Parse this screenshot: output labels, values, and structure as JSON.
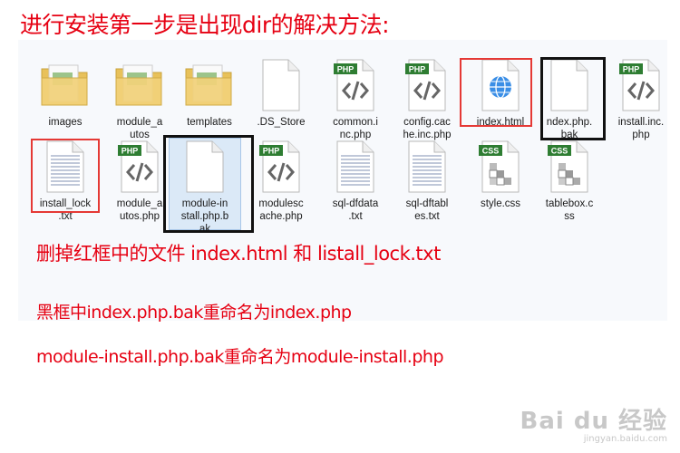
{
  "heading": "进行安装第一步是出现dir的解决方法:",
  "files": [
    {
      "name": "images",
      "icon": "folder-icon"
    },
    {
      "name": "module_a\nutos",
      "icon": "folder-icon"
    },
    {
      "name": "templates",
      "icon": "folder-icon"
    },
    {
      "name": ".DS_Store",
      "icon": "generic-file-icon"
    },
    {
      "name": "common.i\nnc.php",
      "icon": "php-file-icon",
      "badge": "PHP"
    },
    {
      "name": "config.cac\nhe.inc.php",
      "icon": "php-file-icon",
      "badge": "PHP"
    },
    {
      "name": "index.html",
      "icon": "html-file-icon"
    },
    {
      "name": "ndex.php.\nbak",
      "icon": "generic-file-icon"
    },
    {
      "name": "install.inc.\nphp",
      "icon": "php-file-icon",
      "badge": "PHP"
    },
    {
      "name": "install_lock\n.txt",
      "icon": "text-file-icon"
    },
    {
      "name": "module_a\nutos.php",
      "icon": "php-file-icon",
      "badge": "PHP"
    },
    {
      "name": "module-in\nstall.php.b\nak",
      "icon": "generic-file-icon"
    },
    {
      "name": "modulesc\nache.php",
      "icon": "php-file-icon",
      "badge": "PHP"
    },
    {
      "name": "sql-dfdata\n.txt",
      "icon": "text-file-icon"
    },
    {
      "name": "sql-dftabl\nes.txt",
      "icon": "text-file-icon"
    },
    {
      "name": "style.css",
      "icon": "css-file-icon",
      "badge": "CSS"
    },
    {
      "name": "tablebox.c\nss",
      "icon": "css-file-icon",
      "badge": "CSS"
    }
  ],
  "notes": {
    "line1": "删掉红框中的文件 index.html 和 listall_lock.txt",
    "line2": "黑框中index.php.bak重命名为index.php",
    "line3": "module-install.php.bak重命名为module-install.php"
  },
  "watermark": {
    "main": "Bai du 经验",
    "sub": "jingyan.baidu.com"
  },
  "colors": {
    "annotation_red": "#e60012",
    "frame_red": "#e53935",
    "frame_black": "#111111",
    "php_badge": "#2e7d32",
    "css_badge": "#2e7d32"
  }
}
